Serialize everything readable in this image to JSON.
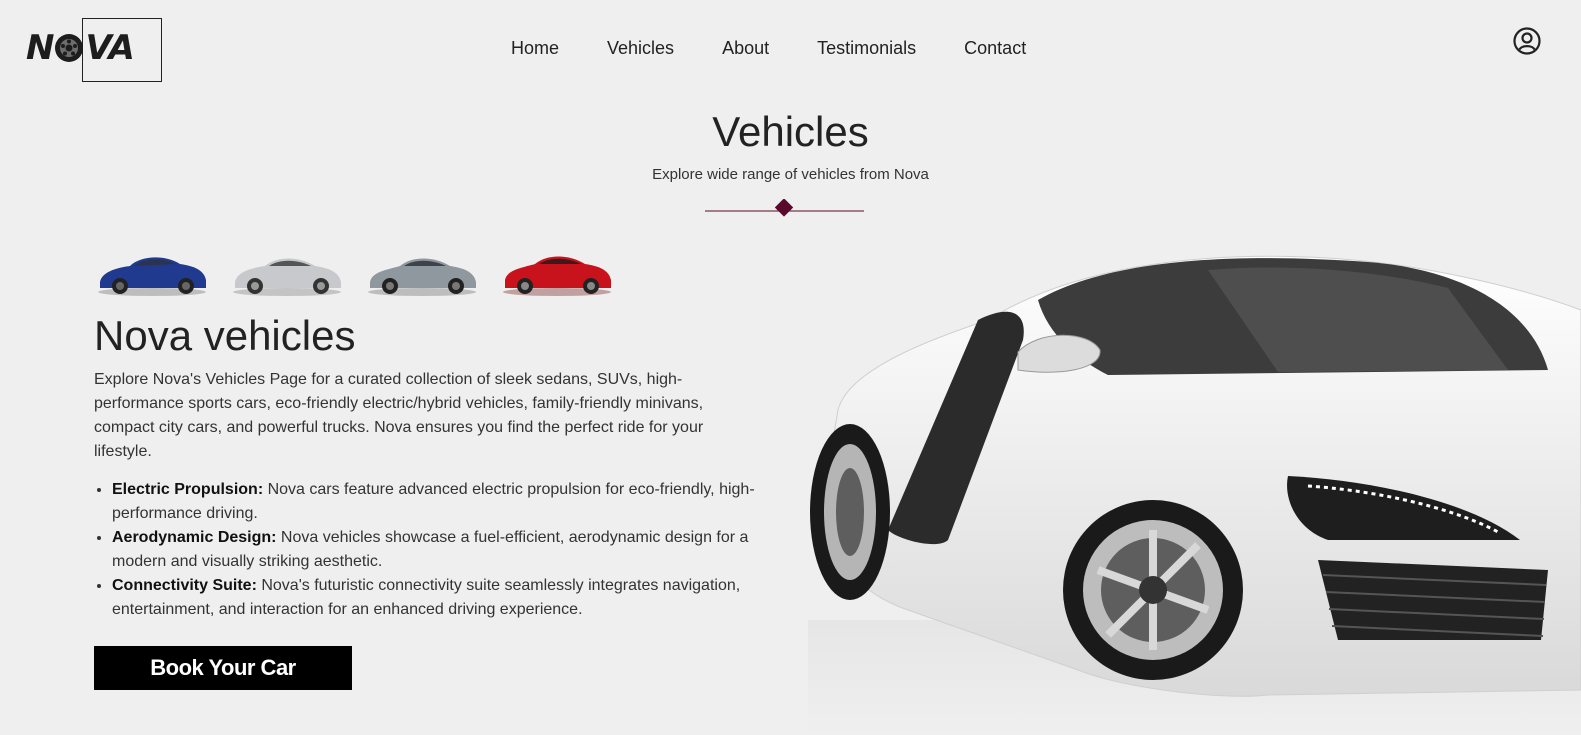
{
  "brand": {
    "logo_text_left": "N",
    "logo_text_right": "VA"
  },
  "nav": {
    "items": [
      "Home",
      "Vehicles",
      "About",
      "Testimonials",
      "Contact"
    ]
  },
  "section": {
    "title": "Vehicles",
    "subtitle": "Explore wide range of vehicles from Nova",
    "accent_color": "#5a0a2a"
  },
  "thumbnails": [
    {
      "name": "blue-coupe",
      "color": "#1f3a8f"
    },
    {
      "name": "silver-sedan",
      "color": "#c7c9cc"
    },
    {
      "name": "grey-sports",
      "color": "#8f979f"
    },
    {
      "name": "red-sports",
      "color": "#c8131c"
    }
  ],
  "content": {
    "heading": "Nova vehicles",
    "description": "Explore Nova's Vehicles Page for a curated collection of sleek sedans, SUVs, high-performance sports cars, eco-friendly electric/hybrid vehicles, family-friendly minivans, compact city cars, and powerful trucks. Nova ensures you find the perfect ride for your lifestyle.",
    "features": [
      {
        "label": "Electric Propulsion:",
        "text": " Nova cars feature advanced electric propulsion for eco-friendly, high-performance driving."
      },
      {
        "label": "Aerodynamic Design:",
        "text": " Nova vehicles showcase a fuel-efficient, aerodynamic design for a modern and visually striking aesthetic."
      },
      {
        "label": "Connectivity Suite:",
        "text": " Nova's futuristic connectivity suite seamlessly integrates navigation, entertainment, and interaction for an enhanced driving experience."
      }
    ],
    "cta_label": "Book Your Car"
  },
  "icons": {
    "user": "user-circle-icon",
    "logo_wheel": "wheel-icon"
  }
}
